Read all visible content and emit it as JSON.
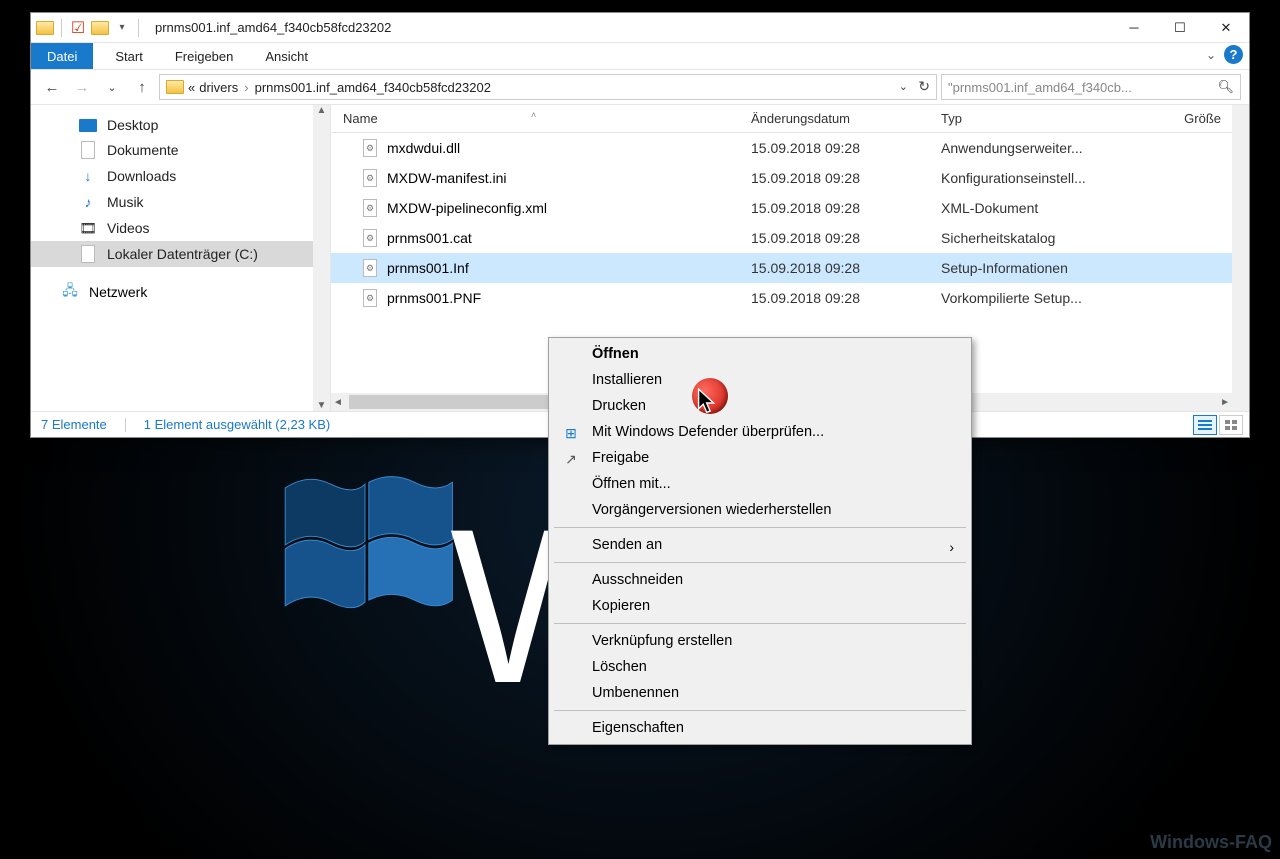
{
  "window": {
    "title": "prnms001.inf_amd64_f340cb58fcd23202"
  },
  "ribbon": {
    "file": "Datei",
    "tabs": [
      "Start",
      "Freigeben",
      "Ansicht"
    ]
  },
  "address": {
    "prefix": "«",
    "segments": [
      "drivers",
      "prnms001.inf_amd64_f340cb58fcd23202"
    ]
  },
  "search": {
    "placeholder": "\"prnms001.inf_amd64_f340cb..."
  },
  "sidebar": {
    "items": [
      {
        "label": "Desktop",
        "icon": "desktop"
      },
      {
        "label": "Dokumente",
        "icon": "document"
      },
      {
        "label": "Downloads",
        "icon": "download"
      },
      {
        "label": "Musik",
        "icon": "music"
      },
      {
        "label": "Videos",
        "icon": "video"
      },
      {
        "label": "Lokaler Datenträger (C:)",
        "icon": "disk",
        "selected": true
      }
    ],
    "network": "Netzwerk"
  },
  "columns": {
    "name": "Name",
    "date": "Änderungsdatum",
    "type": "Typ",
    "size": "Größe"
  },
  "files": [
    {
      "name": "mxdwdui.dll",
      "date": "15.09.2018 09:28",
      "type": "Anwendungserweiter..."
    },
    {
      "name": "MXDW-manifest.ini",
      "date": "15.09.2018 09:28",
      "type": "Konfigurationseinstell..."
    },
    {
      "name": "MXDW-pipelineconfig.xml",
      "date": "15.09.2018 09:28",
      "type": "XML-Dokument"
    },
    {
      "name": "prnms001.cat",
      "date": "15.09.2018 09:28",
      "type": "Sicherheitskatalog"
    },
    {
      "name": "prnms001.Inf",
      "date": "15.09.2018 09:28",
      "type": "Setup-Informationen",
      "selected": true
    },
    {
      "name": "prnms001.PNF",
      "date": "15.09.2018 09:28",
      "type": "Vorkompilierte Setup..."
    }
  ],
  "status": {
    "count": "7 Elemente",
    "selection": "1 Element ausgewählt (2,23 KB)"
  },
  "context_menu": {
    "open": "Öffnen",
    "install": "Installieren",
    "print": "Drucken",
    "defender": "Mit Windows Defender überprüfen...",
    "share": "Freigabe",
    "open_with": "Öffnen mit...",
    "restore": "Vorgängerversionen wiederherstellen",
    "send_to": "Senden an",
    "cut": "Ausschneiden",
    "copy": "Kopieren",
    "shortcut": "Verknüpfung erstellen",
    "delete": "Löschen",
    "rename": "Umbenennen",
    "properties": "Eigenschaften"
  },
  "watermark": "Windows-FAQ"
}
